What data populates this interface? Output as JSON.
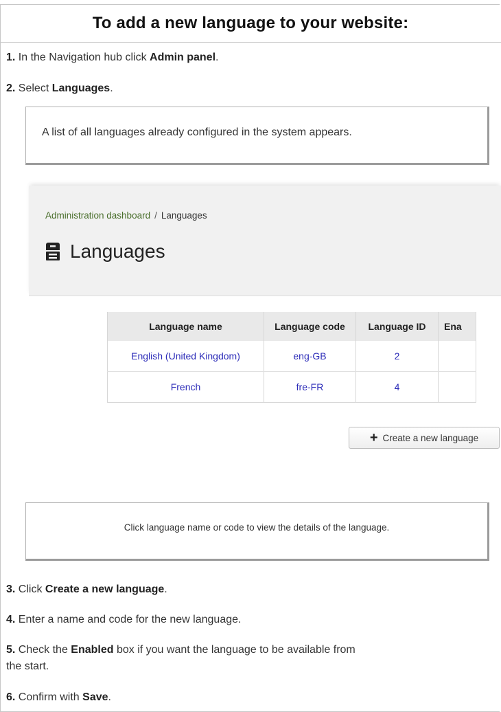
{
  "heading": "To add a new language to your website:",
  "steps": [
    {
      "num": "1.",
      "pre": "In the Navigation hub click ",
      "bold": "Admin panel",
      "post": "."
    },
    {
      "num": "2.",
      "pre": "Select ",
      "bold": "Languages",
      "post": "."
    },
    {
      "num": "3.",
      "pre": "Click ",
      "bold": "Create a new language",
      "post": "."
    },
    {
      "num": "4.",
      "pre": "Enter a name and code for the new language.",
      "bold": "",
      "post": ""
    },
    {
      "num": "5.",
      "pre": "Check the ",
      "bold": "Enabled",
      "post": " box if you want the language to be available from",
      "line2": "the start."
    },
    {
      "num": "6.",
      "pre": "Confirm with ",
      "bold": "Save",
      "post": "."
    }
  ],
  "notes": {
    "list_info": "A list of all languages already configured in the system appears.",
    "click_info": "Click language name or code to view the details of the language."
  },
  "app": {
    "breadcrumb": {
      "link": "Administration dashboard",
      "separator": "/",
      "current": "Languages"
    },
    "page_title": "Languages",
    "table": {
      "headers": [
        "Language name",
        "Language code",
        "Language ID",
        "Ena"
      ],
      "rows": [
        [
          "English (United Kingdom)",
          "eng-GB",
          "2",
          ""
        ],
        [
          "French",
          "fre-FR",
          "4",
          ""
        ]
      ]
    },
    "create_button": "Create a new language"
  }
}
